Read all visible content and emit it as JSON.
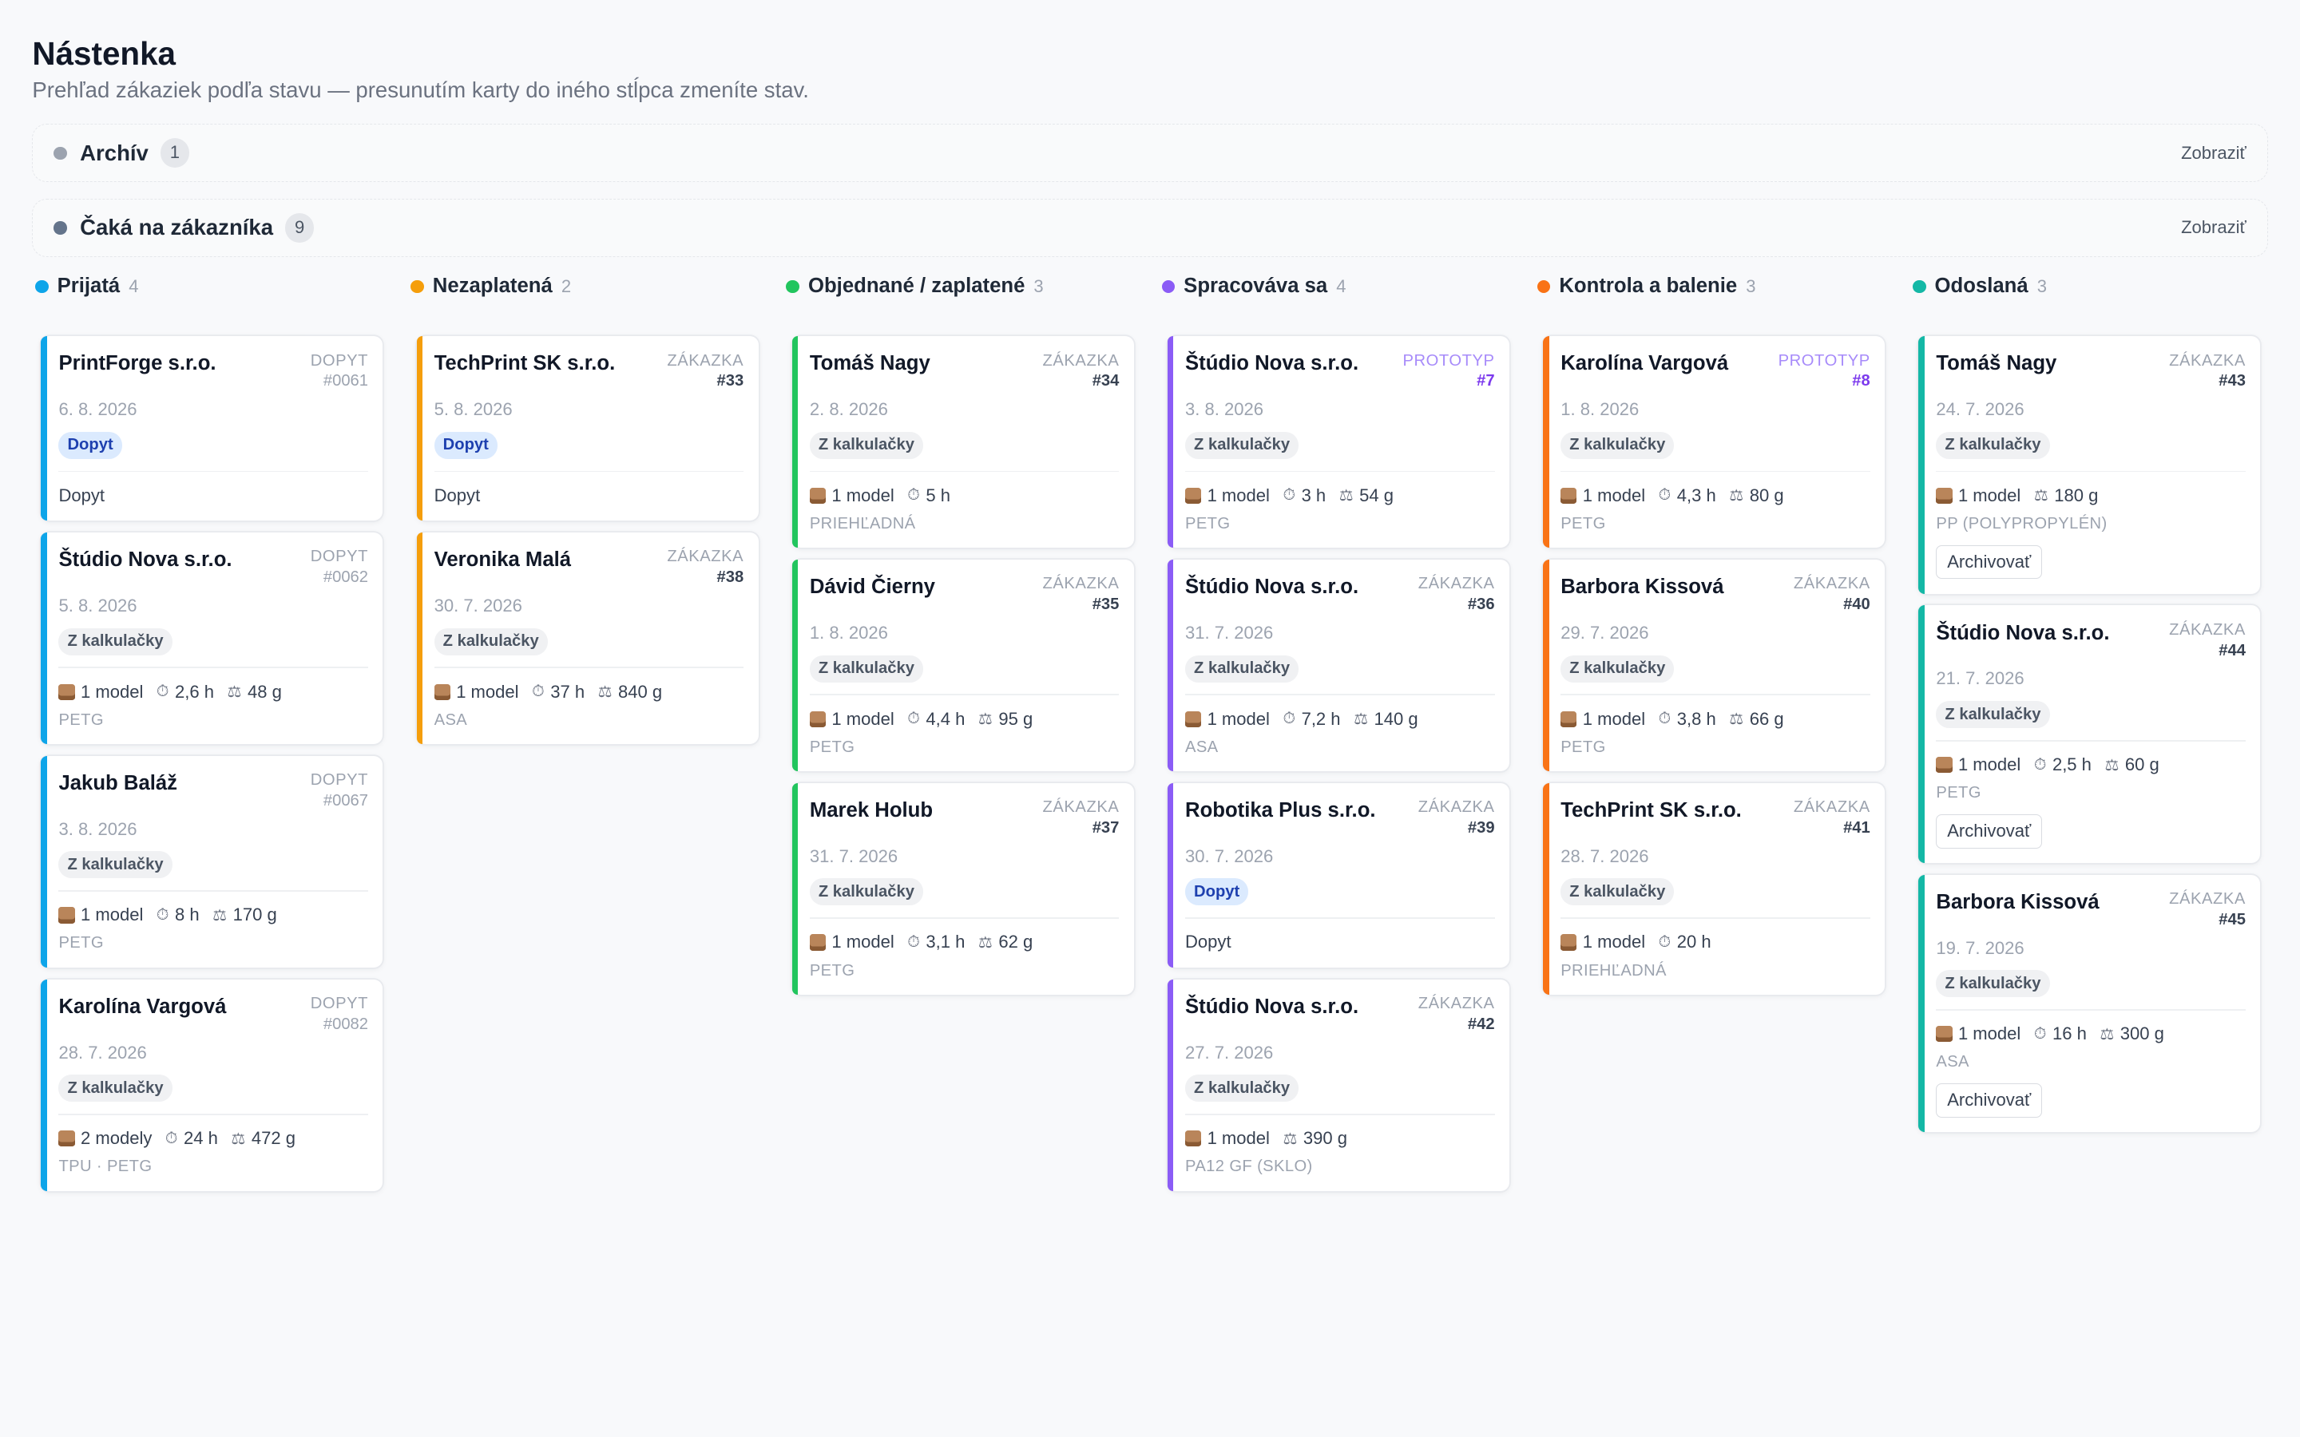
{
  "header": {
    "title": "Nástenka",
    "subtitle": "Prehľad zákaziek podľa stavu — presunutím karty do iného stĺpca zmeníte stav."
  },
  "collapsed_columns": [
    {
      "title": "Archív",
      "count": "1",
      "action": "Zobraziť",
      "color": "#9ca3af"
    },
    {
      "title": "Čaká na zákazníka",
      "count": "9",
      "action": "Zobraziť",
      "color": "#64748b"
    }
  ],
  "columns": [
    {
      "title": "Prijatá",
      "count": "4",
      "color": "#0ea5e9",
      "cards": [
        {
          "name": "PrintForge s.r.o.",
          "kind": "DOPYT",
          "num": "#0061",
          "date": "6. 8. 2026",
          "tag": "Dopyt",
          "plain": "Dopyt"
        },
        {
          "name": "Štúdio Nova s.r.o.",
          "kind": "DOPYT",
          "num": "#0062",
          "date": "5. 8. 2026",
          "tag": "Z kalkulačky",
          "models": "1 model",
          "time": "2,6 h",
          "weight": "48 g",
          "material": "PETG"
        },
        {
          "name": "Jakub Baláž",
          "kind": "DOPYT",
          "num": "#0067",
          "date": "3. 8. 2026",
          "tag": "Z kalkulačky",
          "models": "1 model",
          "time": "8 h",
          "weight": "170 g",
          "material": "PETG"
        },
        {
          "name": "Karolína Vargová",
          "kind": "DOPYT",
          "num": "#0082",
          "date": "28. 7. 2026",
          "tag": "Z kalkulačky",
          "models": "2 modely",
          "time": "24 h",
          "weight": "472 g",
          "material": "TPU · PETG"
        }
      ]
    },
    {
      "title": "Nezaplatená",
      "count": "2",
      "color": "#f59e0b",
      "cards": [
        {
          "name": "TechPrint SK s.r.o.",
          "kind": "ZÁKAZKA",
          "num": "#33",
          "date": "5. 8. 2026",
          "tag": "Dopyt",
          "plain": "Dopyt"
        },
        {
          "name": "Veronika Malá",
          "kind": "ZÁKAZKA",
          "num": "#38",
          "date": "30. 7. 2026",
          "tag": "Z kalkulačky",
          "models": "1 model",
          "time": "37 h",
          "weight": "840 g",
          "material": "ASA"
        }
      ]
    },
    {
      "title": "Objednané / zaplatené",
      "count": "3",
      "color": "#22c55e",
      "cards": [
        {
          "name": "Tomáš Nagy",
          "kind": "ZÁKAZKA",
          "num": "#34",
          "date": "2. 8. 2026",
          "tag": "Z kalkulačky",
          "models": "1 model",
          "time": "5 h",
          "material": "PRIEHĽADNÁ"
        },
        {
          "name": "Dávid Čierny",
          "kind": "ZÁKAZKA",
          "num": "#35",
          "date": "1. 8. 2026",
          "tag": "Z kalkulačky",
          "models": "1 model",
          "time": "4,4 h",
          "weight": "95 g",
          "material": "PETG"
        },
        {
          "name": "Marek Holub",
          "kind": "ZÁKAZKA",
          "num": "#37",
          "date": "31. 7. 2026",
          "tag": "Z kalkulačky",
          "models": "1 model",
          "time": "3,1 h",
          "weight": "62 g",
          "material": "PETG"
        }
      ]
    },
    {
      "title": "Spracováva sa",
      "count": "4",
      "color": "#8b5cf6",
      "cards": [
        {
          "name": "Štúdio Nova s.r.o.",
          "kind": "PROTOTYP",
          "num": "#7",
          "date": "3. 8. 2026",
          "tag": "Z kalkulačky",
          "models": "1 model",
          "time": "3 h",
          "weight": "54 g",
          "material": "PETG"
        },
        {
          "name": "Štúdio Nova s.r.o.",
          "kind": "ZÁKAZKA",
          "num": "#36",
          "date": "31. 7. 2026",
          "tag": "Z kalkulačky",
          "models": "1 model",
          "time": "7,2 h",
          "weight": "140 g",
          "material": "ASA"
        },
        {
          "name": "Robotika Plus s.r.o.",
          "kind": "ZÁKAZKA",
          "num": "#39",
          "date": "30. 7. 2026",
          "tag": "Dopyt",
          "plain": "Dopyt"
        },
        {
          "name": "Štúdio Nova s.r.o.",
          "kind": "ZÁKAZKA",
          "num": "#42",
          "date": "27. 7. 2026",
          "tag": "Z kalkulačky",
          "models": "1 model",
          "weight": "390 g",
          "material": "PA12 GF (SKLO)"
        }
      ]
    },
    {
      "title": "Kontrola a balenie",
      "count": "3",
      "color": "#f97316",
      "cards": [
        {
          "name": "Karolína Vargová",
          "kind": "PROTOTYP",
          "num": "#8",
          "date": "1. 8. 2026",
          "tag": "Z kalkulačky",
          "models": "1 model",
          "time": "4,3 h",
          "weight": "80 g",
          "material": "PETG"
        },
        {
          "name": "Barbora Kissová",
          "kind": "ZÁKAZKA",
          "num": "#40",
          "date": "29. 7. 2026",
          "tag": "Z kalkulačky",
          "models": "1 model",
          "time": "3,8 h",
          "weight": "66 g",
          "material": "PETG"
        },
        {
          "name": "TechPrint SK s.r.o.",
          "kind": "ZÁKAZKA",
          "num": "#41",
          "date": "28. 7. 2026",
          "tag": "Z kalkulačky",
          "models": "1 model",
          "time": "20 h",
          "material": "PRIEHĽADNÁ"
        }
      ]
    },
    {
      "title": "Odoslaná",
      "count": "3",
      "color": "#14b8a6",
      "cards": [
        {
          "name": "Tomáš Nagy",
          "kind": "ZÁKAZKA",
          "num": "#43",
          "date": "24. 7. 2026",
          "tag": "Z kalkulačky",
          "models": "1 model",
          "weight": "180 g",
          "material": "PP (POLYPROPYLÉN)",
          "archive": "Archivovať"
        },
        {
          "name": "Štúdio Nova s.r.o.",
          "kind": "ZÁKAZKA",
          "num": "#44",
          "date": "21. 7. 2026",
          "tag": "Z kalkulačky",
          "models": "1 model",
          "time": "2,5 h",
          "weight": "60 g",
          "material": "PETG",
          "archive": "Archivovať"
        },
        {
          "name": "Barbora Kissová",
          "kind": "ZÁKAZKA",
          "num": "#45",
          "date": "19. 7. 2026",
          "tag": "Z kalkulačky",
          "models": "1 model",
          "time": "16 h",
          "weight": "300 g",
          "material": "ASA",
          "archive": "Archivovať"
        }
      ]
    }
  ]
}
